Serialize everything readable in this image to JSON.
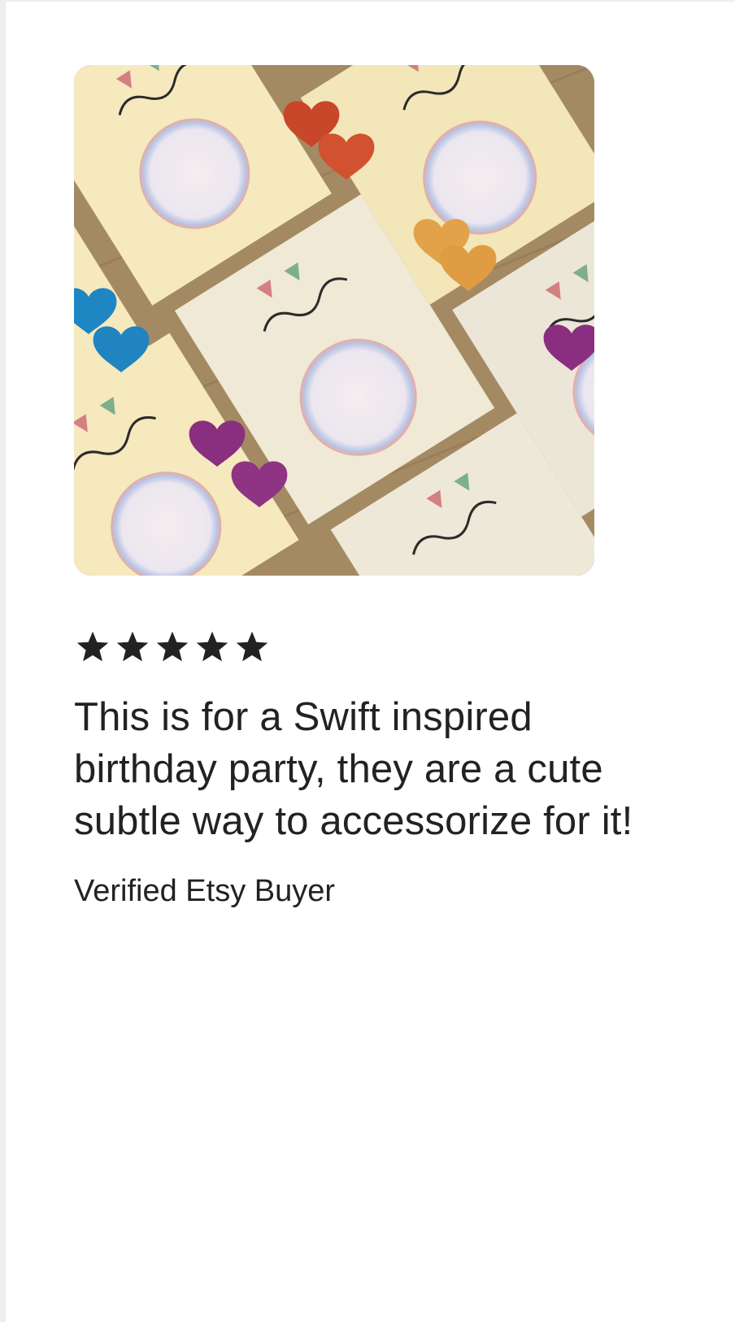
{
  "review": {
    "photo_alt": "Heart-shaped earrings on Creativity display cards",
    "rating": 5,
    "rating_max": 5,
    "star_icon": "star-icon",
    "text": "This is for a Swift inspired birthday party, they are a cute subtle way to accessorize for it!",
    "reviewer": "Verified Etsy Buyer"
  },
  "colors": {
    "text": "#222222",
    "star": "#222222",
    "background": "#ffffff"
  }
}
